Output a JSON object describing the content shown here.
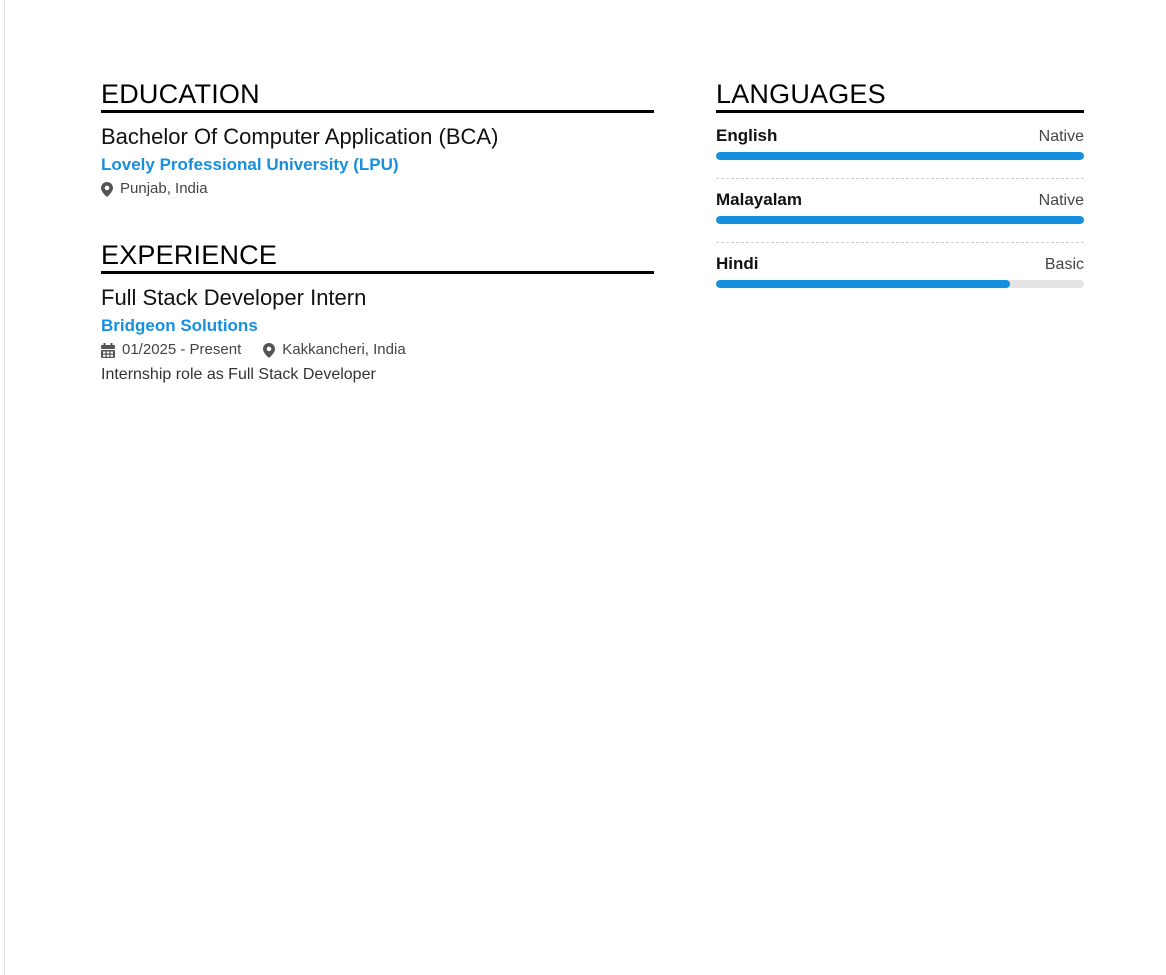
{
  "education": {
    "heading": "EDUCATION",
    "entries": [
      {
        "degree": "Bachelor Of Computer Application (BCA)",
        "school": "Lovely Professional University (LPU)",
        "location": "Punjab, India",
        "location_icon": "map-pin-icon"
      }
    ]
  },
  "experience": {
    "heading": "EXPERIENCE",
    "entries": [
      {
        "title": "Full Stack Developer Intern",
        "company": "Bridgeon Solutions",
        "dates": "01/2025 - Present",
        "dates_icon": "calendar-icon",
        "location": "Kakkancheri, India",
        "location_icon": "map-pin-icon",
        "description": "Internship role as Full Stack Developer"
      }
    ]
  },
  "languages": {
    "heading": "LANGUAGES",
    "items": [
      {
        "name": "English",
        "level": "Native",
        "proficiency": 1.0
      },
      {
        "name": "Malayalam",
        "level": "Native",
        "proficiency": 1.0
      },
      {
        "name": "Hindi",
        "level": "Basic",
        "proficiency": 0.8
      }
    ]
  },
  "colors": {
    "accent": "#178fdf",
    "heading": "#000000",
    "bar_track": "#e4e4e4"
  }
}
